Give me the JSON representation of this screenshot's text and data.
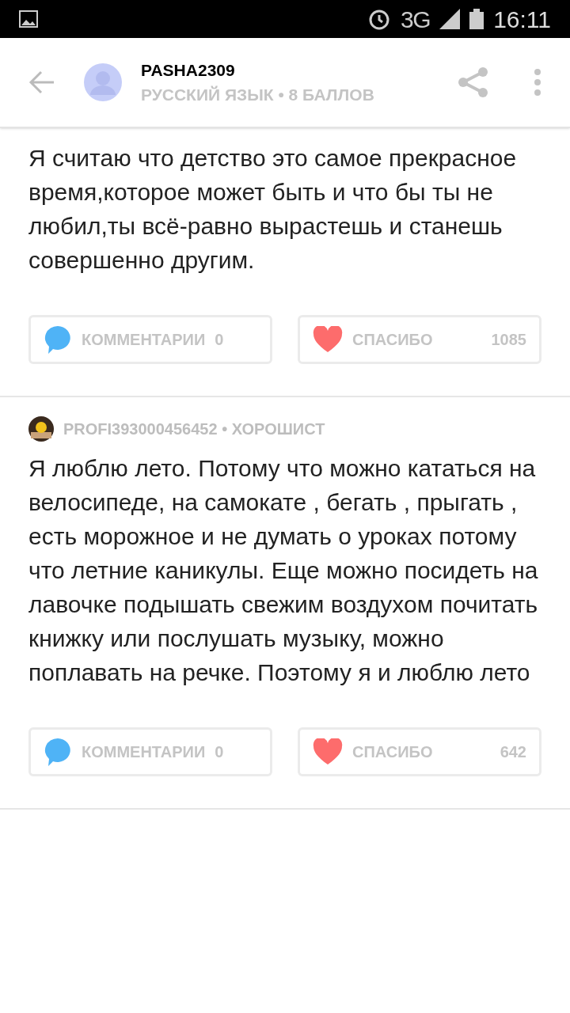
{
  "status_bar": {
    "network": "3G",
    "time": "16:11"
  },
  "header": {
    "username": "PASHA2309",
    "subtitle": "РУССКИЙ ЯЗЫК • 8 БАЛЛОВ"
  },
  "answers": [
    {
      "text": "Я считаю что детство это самое прекрасное время,которое может быть и что бы ты не любил,ты всё-равно вырастешь и станешь совершенно другим.",
      "comments": {
        "label": "КОММЕНТАРИИ",
        "count": "0"
      },
      "thanks": {
        "label": "СПАСИБО",
        "count": "1085"
      }
    },
    {
      "author": "PROFI393000456452 • ХОРОШИСТ",
      "text": "Я люблю лето. Потому что можно кататься на велосипеде, на самокате , бегать , прыгать , есть морожное и не думать о уроках потому что летние каникулы. Еще можно посидеть на лавочке подышать свежим воздухом почитать книжку или послушать музыку, можно поплавать на речке. Поэтому я и люблю лето",
      "comments": {
        "label": "КОММЕНТАРИИ",
        "count": "0"
      },
      "thanks": {
        "label": "СПАСИБО",
        "count": "642"
      }
    }
  ]
}
